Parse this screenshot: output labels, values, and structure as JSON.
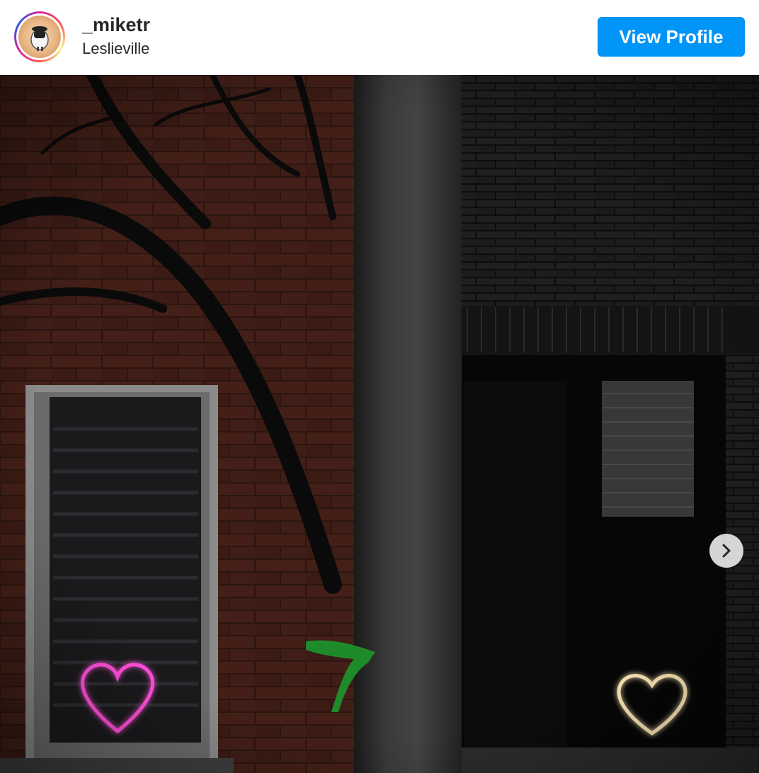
{
  "post_header": {
    "username": "_miketr",
    "location": "Leslieville",
    "view_profile_label": "View Profile",
    "avatar_icon": "profile-avatar"
  },
  "photo": {
    "description_icon": "post-photo",
    "next_icon": "chevron-right-icon"
  },
  "colors": {
    "accent": "#0095f6",
    "pink_neon": "#ff4fd8",
    "warm_neon": "#ffe9b8"
  }
}
